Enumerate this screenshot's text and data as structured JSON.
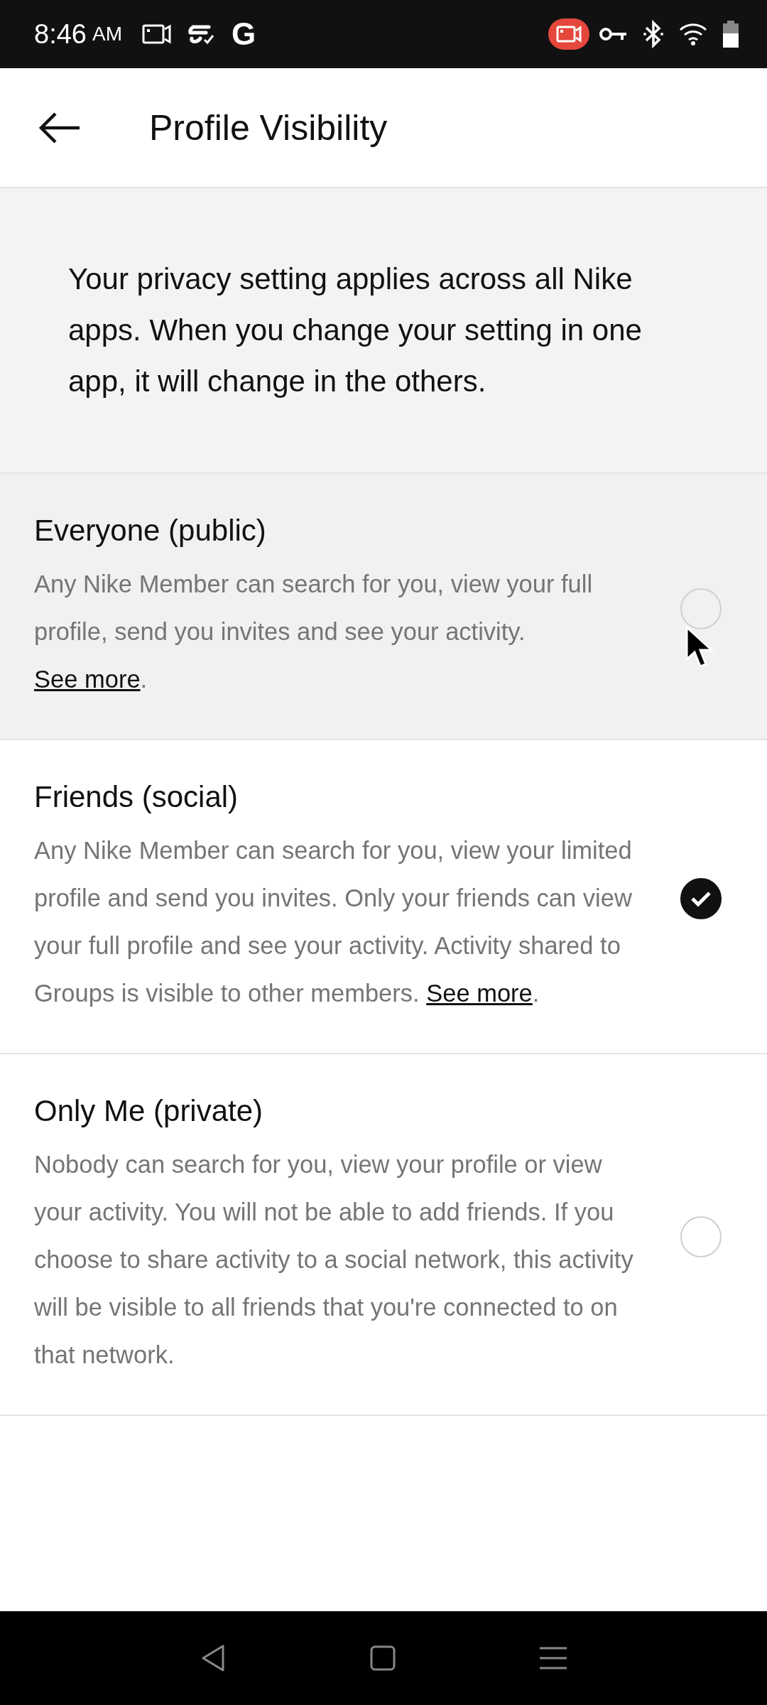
{
  "status_bar": {
    "time": "8:46",
    "ampm": "AM",
    "g_label": "G"
  },
  "header": {
    "title": "Profile Visibility"
  },
  "intro": "Your privacy setting applies across all Nike apps. When you change your setting in one app, it will change in the others.",
  "options": [
    {
      "title": "Everyone (public)",
      "description": "Any Nike Member can search for you, view your full profile, send you invites and see your activity. ",
      "link": "See more",
      "suffix": ".",
      "selected": false,
      "pressed": true
    },
    {
      "title": "Friends (social)",
      "description": "Any Nike Member can search for you, view your limited profile and send you invites. Only your friends can view your full profile and see your activity. Activity shared to Groups is visible to other members. ",
      "link": "See more",
      "suffix": ".",
      "selected": true,
      "pressed": false
    },
    {
      "title": "Only Me (private)",
      "description": "Nobody can search for you, view your profile or view your activity. You will not be able to add friends. If you choose to share activity to a social network, this activity will be visible to all friends that you're connected to on that network.",
      "selected": false,
      "pressed": false
    }
  ]
}
